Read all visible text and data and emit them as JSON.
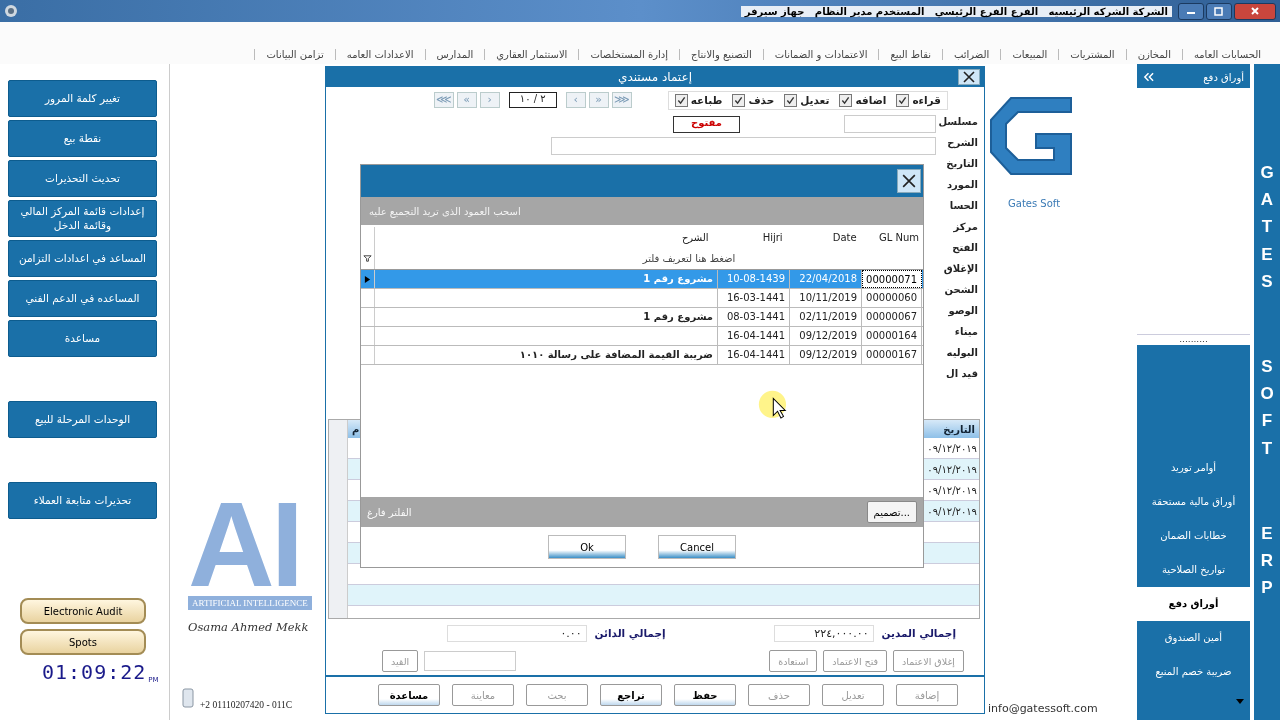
{
  "title_bar": {
    "text": "الشركة الشركه الرئيسيه   الفرع الفرع الرئيسي   المستخدم مدير النظام   جهاز سيرفر"
  },
  "menu": [
    "الحسابات العامه",
    "المخازن",
    "المشتريات",
    "المبيعات",
    "الضرائب",
    "نقاط البيع",
    "الاعتمادات و الضمانات",
    "التصنيع والانتاج",
    "إدارة المستخلصات",
    "الاستثمار العقاري",
    "المدارس",
    "الاعدادات العامه",
    "تزامن البيانات"
  ],
  "left_menu": [
    [
      "تغيير كلمة المرور",
      "نقطة بيع",
      "تحديث التحذيرات",
      "إعدادات قائمة المركز المالي وقائمة الدخل",
      "المساعد في اعدادات التزامن",
      "المساعده في الدعم الفني",
      "مساعدة"
    ],
    [
      "الوحدات المرحلة للبيع"
    ],
    [
      "تحذيرات متابعة العملاء"
    ]
  ],
  "audit_buttons": [
    "Electronic Audit",
    "Spots"
  ],
  "clock": {
    "time": "01:09:22",
    "suffix": "PM"
  },
  "ai_logo": {
    "letters": "AI",
    "tagline": "ARTIFICIAL INTELLIGENCE",
    "signature": "Osama Ahmed Mekk"
  },
  "phone": "+2 01110207420  - 011C",
  "email": "info@gatessoft.com",
  "gates_logo": {
    "caption": "Gates Soft"
  },
  "right_panel": {
    "header": "أوراق دفع",
    "dots": "..........",
    "items": [
      {
        "label": "أوامر توريد",
        "selected": false
      },
      {
        "label": "أوراق مالية مستحقة",
        "selected": false
      },
      {
        "label": "خطابات الضمان",
        "selected": false
      },
      {
        "label": "تواريخ الصلاحية",
        "selected": false
      },
      {
        "label": "أوراق دفع",
        "selected": true
      },
      {
        "label": "أمين الصندوق",
        "selected": false
      },
      {
        "label": "ضريبة خصم المنبع",
        "selected": false
      }
    ]
  },
  "brand_strip": [
    "GATES",
    "SOFT",
    "ERP"
  ],
  "main_window": {
    "title": "إعتماد مستندي",
    "permissions": [
      {
        "label": "قراءه",
        "checked": true
      },
      {
        "label": "اضافه",
        "checked": true
      },
      {
        "label": "تعديل",
        "checked": true
      },
      {
        "label": "حذف",
        "checked": true
      },
      {
        "label": "طباعه",
        "checked": true
      }
    ],
    "nav_buttons": [
      "⋙",
      "»",
      "‹",
      "›",
      "«",
      "⋘"
    ],
    "record": "٢ / ١٠",
    "labels": [
      "مسلسل",
      "الشرح",
      "التاريخ",
      "المورد",
      "الحسا",
      "مركز",
      "الفتح",
      "الإغلاق",
      "الشحن",
      "الوصو",
      "ميناء",
      "البوليه",
      "قيد ال"
    ],
    "status": "مفتوح",
    "grid": {
      "column_1": "التاريخ",
      "column_2": "م",
      "rows": [
        "٠٩/١٢/٢٠١٩",
        "٠٩/١٢/٢٠١٩",
        "٠٩/١٢/٢٠١٩",
        "٠٩/١٢/٢٠١٩"
      ]
    },
    "totals": [
      {
        "label": "إجمالي المدين",
        "value": "٢٢٤,٠٠٠.٠٠"
      },
      {
        "label": "إجمالي الدائن",
        "value": "٠.٠٠"
      }
    ],
    "actions": [
      {
        "label": "إغلاق الاعتماد",
        "disabled": true
      },
      {
        "label": "فتح الاعتماد",
        "disabled": true
      },
      {
        "label": "استعادة",
        "disabled": true
      }
    ],
    "entry_button": {
      "label": "القيد",
      "disabled": true
    },
    "buttons": [
      {
        "label": "إضافة",
        "disabled": true
      },
      {
        "label": "تعديل",
        "disabled": true
      },
      {
        "label": "حذف",
        "disabled": true
      },
      {
        "label": "حفظ",
        "disabled": false
      },
      {
        "label": "تراجع",
        "disabled": false
      },
      {
        "label": "بحث",
        "disabled": true
      },
      {
        "label": "معاينة",
        "disabled": true
      },
      {
        "label": "مساعدة",
        "disabled": false
      }
    ]
  },
  "filter_dialog": {
    "banner": "اسحب العمود الذى تريد التجميع عليه",
    "columns": [
      "GL Num",
      "Date",
      "Hijri",
      "الشرح"
    ],
    "filter_hint": "اضغط هنا لتعريف فلتر",
    "rows": [
      {
        "gl": "00000071",
        "date": "22/04/2018",
        "hijri": "10-08-1439",
        "desc": "مشروع رقم 1",
        "selected": true
      },
      {
        "gl": "00000060",
        "date": "10/11/2019",
        "hijri": "16-03-1441",
        "desc": "",
        "selected": false
      },
      {
        "gl": "00000067",
        "date": "02/11/2019",
        "hijri": "08-03-1441",
        "desc": "مشروع رقم 1",
        "selected": false
      },
      {
        "gl": "00000164",
        "date": "09/12/2019",
        "hijri": "16-04-1441",
        "desc": "",
        "selected": false
      },
      {
        "gl": "00000167",
        "date": "09/12/2019",
        "hijri": "16-04-1441",
        "desc": "ضريبة القيمة المضافة على رسالة ١٠١٠",
        "selected": false
      }
    ],
    "footer": "الفلتر فارغ",
    "design_button": "...تصميم",
    "ok": "Ok",
    "cancel": "Cancel"
  }
}
